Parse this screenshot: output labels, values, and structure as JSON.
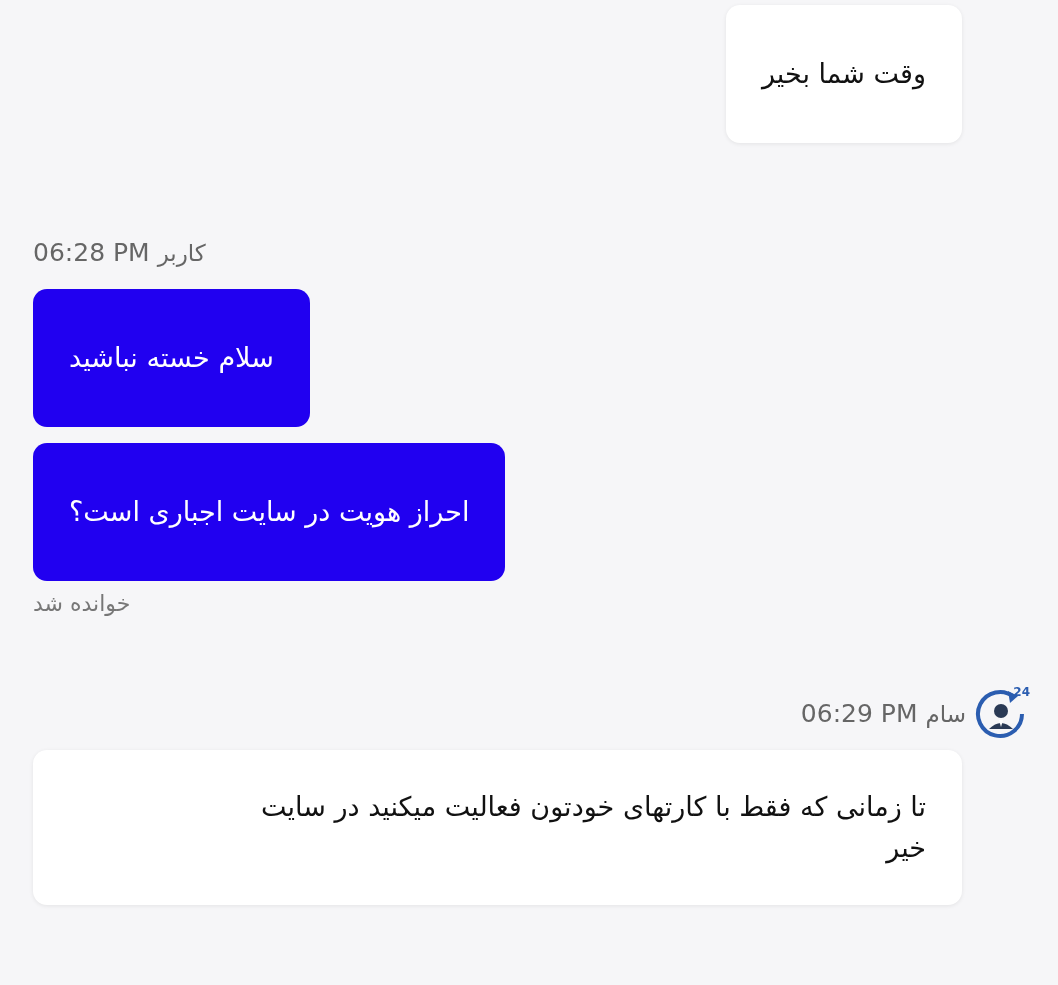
{
  "groups": [
    {
      "kind": "agent",
      "messages": [
        "وقت شما بخیر"
      ]
    },
    {
      "kind": "user",
      "name": "کاربر",
      "time": "06:28 PM",
      "messages": [
        "سلام خسته نباشید",
        "احراز هویت در سایت اجباری است؟"
      ],
      "status": "خوانده شد"
    },
    {
      "kind": "agent",
      "name": "سام",
      "time": "06:29 PM",
      "avatar_badge": "24",
      "messages": [
        "تا زمانی که فقط با کارتهای خودتون فعالیت میکنید در سایت خیر"
      ]
    }
  ]
}
